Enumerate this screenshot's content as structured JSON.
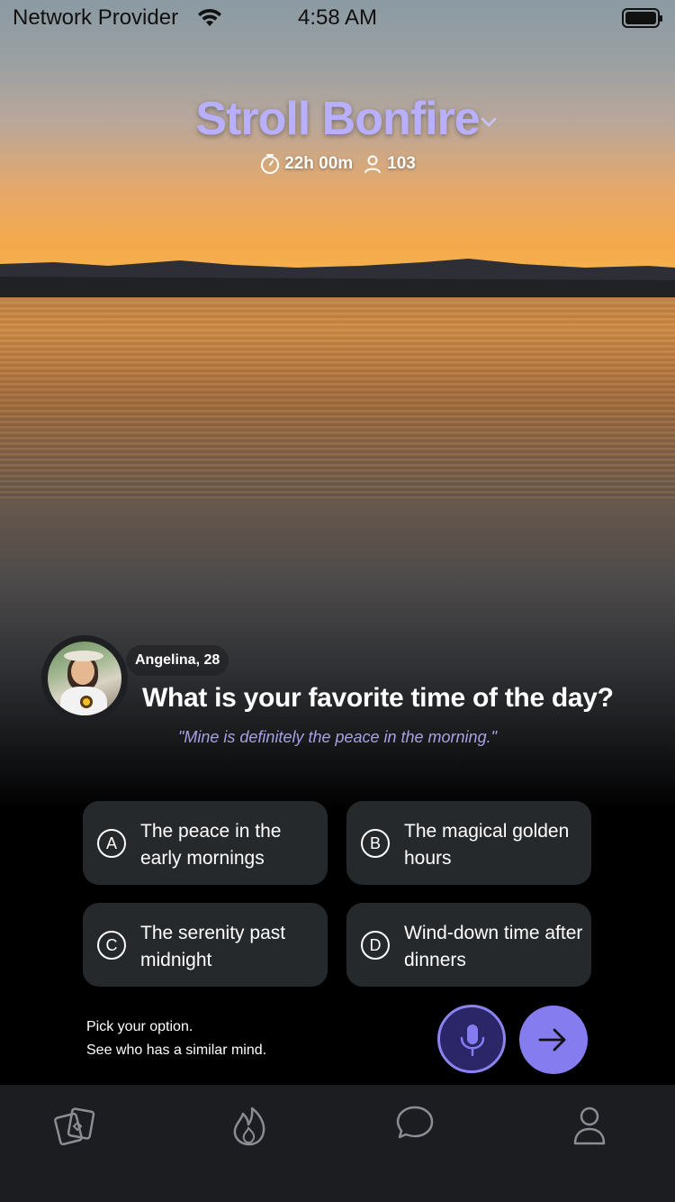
{
  "status_bar": {
    "carrier": "Network Provider",
    "time": "4:58 AM"
  },
  "header": {
    "room_name": "Stroll Bonfire",
    "timer": "22h 00m",
    "participants": "103"
  },
  "question_card": {
    "asker": "Angelina, 28",
    "question": "What is your favorite time of the day?",
    "answer_quote": "\"Mine is definitely the peace in the morning.\""
  },
  "options": [
    {
      "letter": "A",
      "text": "The peace in the early mornings"
    },
    {
      "letter": "B",
      "text": "The magical golden hours"
    },
    {
      "letter": "C",
      "text": "The serenity past midnight"
    },
    {
      "letter": "D",
      "text": "Wind-down time after dinners"
    }
  ],
  "hint": {
    "line1": "Pick your option.",
    "line2": "See who has a similar mind."
  },
  "colors": {
    "accent": "#857cf0",
    "title": "#b8b0ff",
    "quote": "#a7a1e6",
    "option_bg": "#26292c",
    "tabbar_bg": "#1c1d20"
  },
  "icons": {
    "tabs": [
      "cards-icon",
      "flame-icon",
      "chat-bubble-icon",
      "person-icon"
    ]
  }
}
